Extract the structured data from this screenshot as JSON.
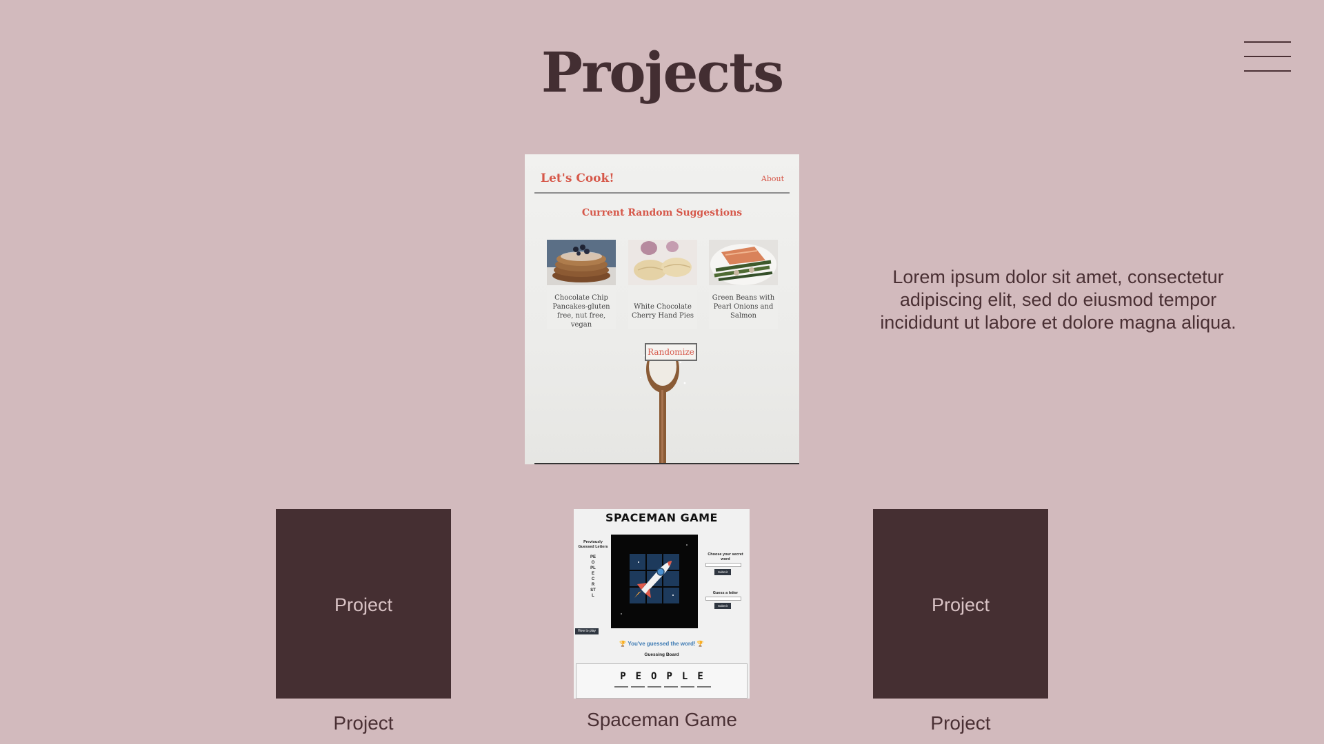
{
  "page": {
    "title": "Projects"
  },
  "featured": {
    "brand": "Let's Cook!",
    "about_link": "About",
    "heading": "Current Random Suggestions",
    "recipes": [
      {
        "name": "Chocolate Chip Pancakes-gluten free, nut free, vegan"
      },
      {
        "name": "White Chocolate Cherry Hand Pies"
      },
      {
        "name": "Green Beans with Pearl Onions and Salmon"
      }
    ],
    "randomize_label": "Randomize",
    "accent_color": "#d6584a"
  },
  "description": "Lorem ipsum dolor sit amet, consectetur adipiscing elit, sed do eiusmod tempor incididunt ut labore et dolore magna aliqua.",
  "projects": [
    {
      "tile_label": "Project",
      "title": "Project"
    },
    {
      "title": "Spaceman Game"
    },
    {
      "tile_label": "Project",
      "title": "Project"
    }
  ],
  "spaceman": {
    "title": "SPACEMAN GAME",
    "previous_letters_label": "Previously Guessed Letters",
    "previous_letters": "PEOPLECRSTL",
    "how_to_label": "How to play",
    "secret_word_label": "Choose your secret word",
    "guess_letter_label": "Guess a letter",
    "submit_label": "Submit",
    "win_message": "🏆 You've guessed the word! 🏆",
    "board_label": "Guessing Board",
    "word": "PEOPLE"
  },
  "colors": {
    "background": "#d2babd",
    "tile": "#452f32",
    "text": "#4a3034"
  }
}
